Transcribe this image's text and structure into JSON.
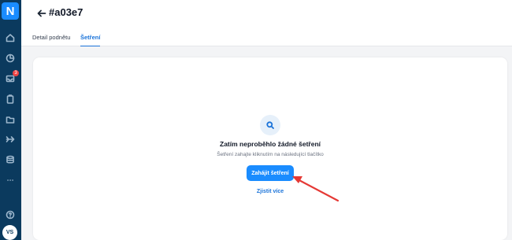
{
  "app": {
    "logo_letter": "N"
  },
  "sidebar": {
    "items": [
      {
        "name": "home-icon"
      },
      {
        "name": "chart-icon"
      },
      {
        "name": "inbox-icon",
        "badge": "3"
      },
      {
        "name": "clipboard-icon"
      },
      {
        "name": "folder-icon"
      },
      {
        "name": "share-icon"
      },
      {
        "name": "database-icon"
      },
      {
        "name": "more-icon"
      },
      {
        "name": "help-icon"
      }
    ],
    "avatar_initials": "VS"
  },
  "header": {
    "title": "#a03e7",
    "tabs": [
      {
        "label": "Detail podnětu",
        "active": false
      },
      {
        "label": "Šetření",
        "active": true
      }
    ]
  },
  "empty_state": {
    "title": "Zatím neproběhlo žádné šetření",
    "subtitle": "Šetření zahajte kliknutím na následující tlačítko",
    "primary_button": "Zahájit šetření",
    "link": "Zjistit více"
  },
  "colors": {
    "sidebar": "#0b3a5e",
    "accent": "#1a8cff",
    "annotation": "#e53935"
  }
}
